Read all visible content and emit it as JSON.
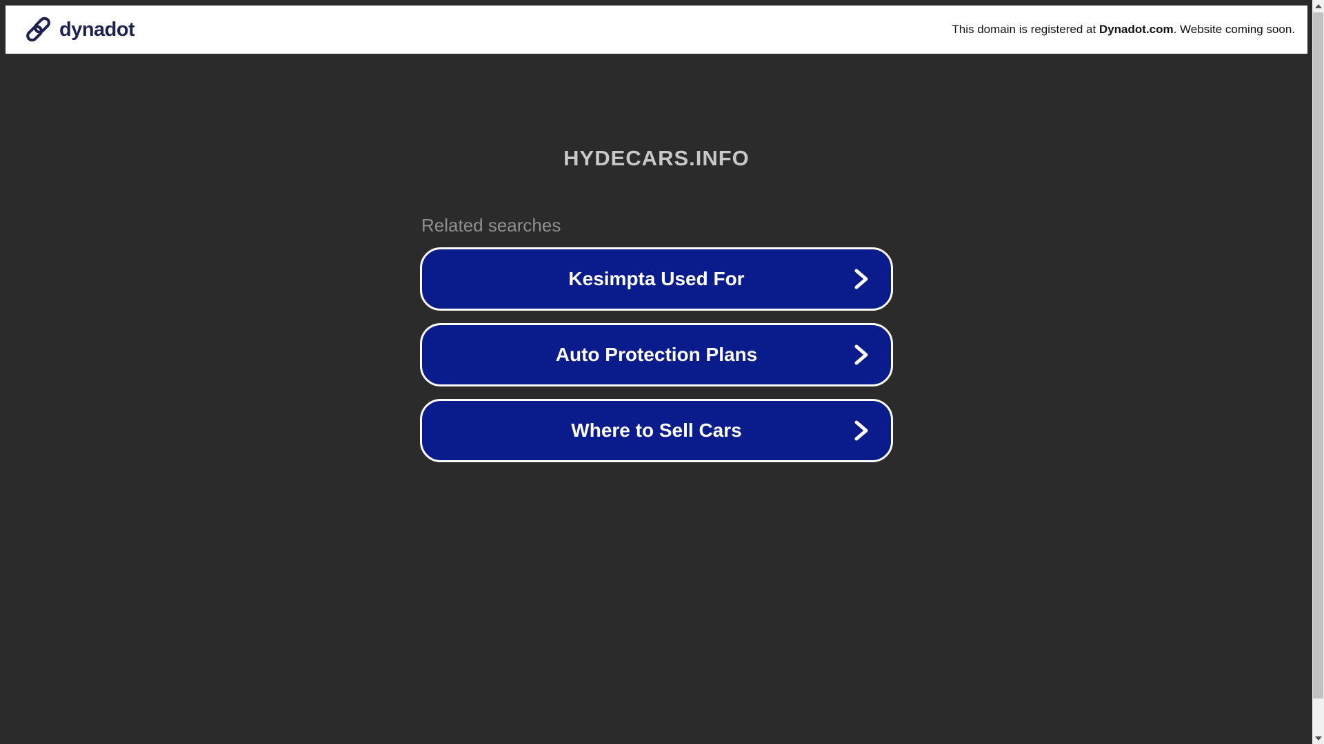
{
  "header": {
    "logo": "dynadot",
    "notice": {
      "prefix": "This domain is registered at ",
      "registrar": "Dynadot.com",
      "suffix": ". Website coming soon."
    }
  },
  "main": {
    "domain": "HYDECARS.INFO",
    "related_label": "Related searches",
    "links": [
      {
        "label": "Kesimpta Used For"
      },
      {
        "label": "Auto Protection Plans"
      },
      {
        "label": "Where to Sell Cars"
      }
    ]
  },
  "icons": {
    "logo_icon": "chain-link",
    "link_icon": "chevron-right"
  },
  "colors": {
    "page_background": "#2b2b2b",
    "header_background": "#ffffff",
    "brand_navy": "#1c2150",
    "button_blue": "#0a1b8c",
    "button_border": "#ffffff",
    "button_text": "#ffffff",
    "title_gray": "#c8c8c8",
    "label_gray": "#8f8f8f",
    "scrollbar_track": "#f1f1f1",
    "scrollbar_thumb": "#c1c1c1"
  }
}
